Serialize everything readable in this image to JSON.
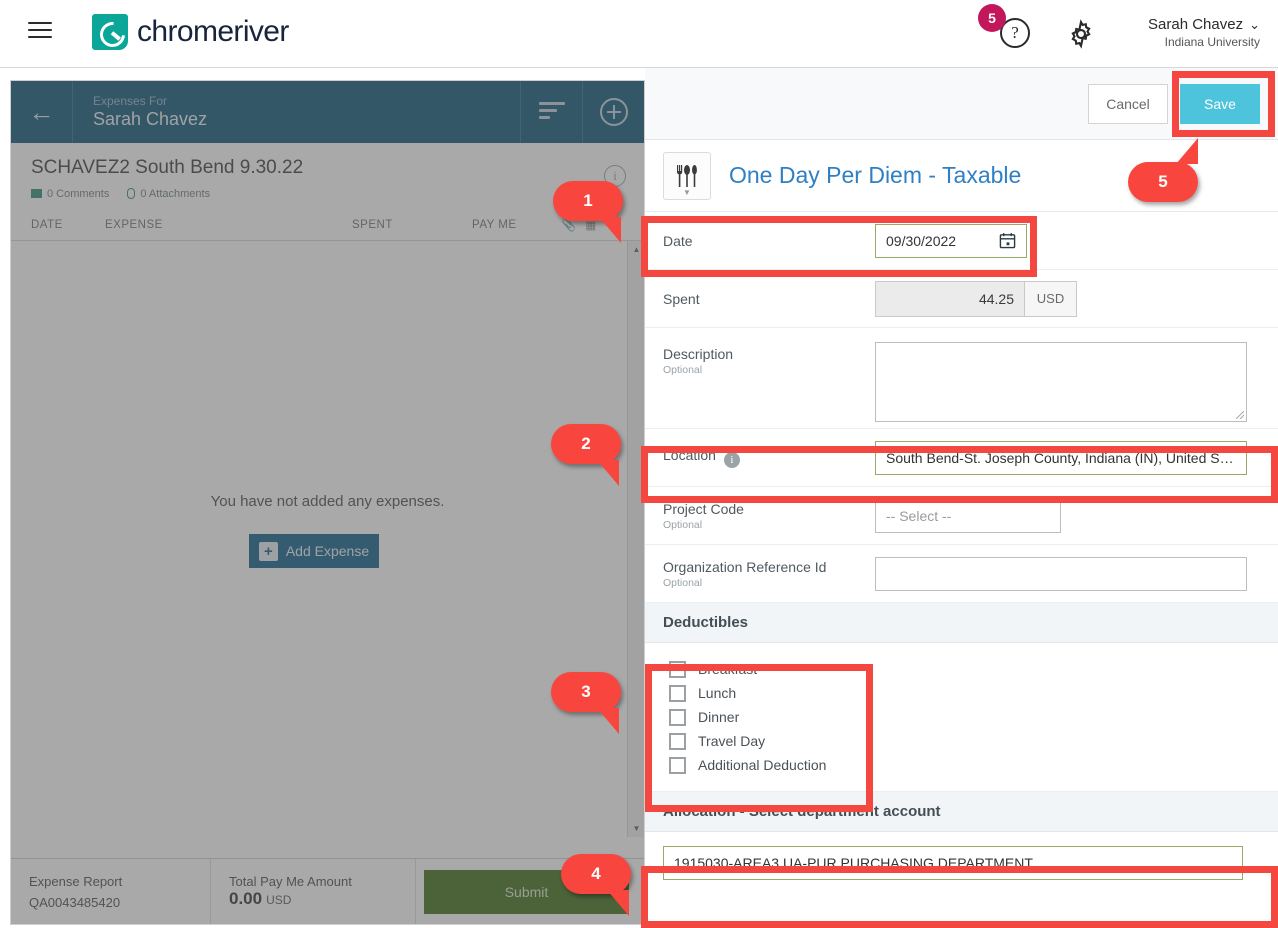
{
  "header": {
    "brand": "chromeriver",
    "menu_icon": "hamburger-icon",
    "notification_count": "5",
    "help_glyph": "?",
    "user_name": "Sarah Chavez",
    "user_caret": "⌄",
    "user_org": "Indiana University"
  },
  "left_panel": {
    "back_glyph": "←",
    "head_small": "Expenses For",
    "head_large": "Sarah Chavez",
    "report_title": "SCHAVEZ2 South Bend 9.30.22",
    "comments": "0 Comments",
    "attachments": "0 Attachments",
    "info_glyph": "i",
    "columns": {
      "date": "DATE",
      "expense": "EXPENSE",
      "spent": "SPENT",
      "pay_me": "PAY ME"
    },
    "empty_message": "You have not added any expenses.",
    "add_expense_label": "Add Expense",
    "add_expense_plus": "+",
    "footer": {
      "report_label": "Expense Report",
      "report_value": "QA0043485420",
      "total_label": "Total Pay Me Amount",
      "total_value": "0.00",
      "total_currency": "USD",
      "submit_label": "Submit"
    },
    "scroll_up": "▲",
    "scroll_down": "▼"
  },
  "right_panel": {
    "cancel_label": "Cancel",
    "save_label": "Save",
    "expense_title": "One Day Per Diem - Taxable",
    "category_icon": "utensils-icon",
    "category_chevron": "▼",
    "fields": {
      "date": {
        "label": "Date",
        "value": "09/30/2022"
      },
      "spent": {
        "label": "Spent",
        "value": "44.25",
        "currency": "USD"
      },
      "description": {
        "label": "Description",
        "sub": "Optional",
        "value": ""
      },
      "location": {
        "label": "Location",
        "info": "i",
        "value": "South Bend-St. Joseph County, Indiana (IN), United S…"
      },
      "project_code": {
        "label": "Project Code",
        "sub": "Optional",
        "placeholder": "-- Select --"
      },
      "org_ref": {
        "label": "Organization Reference Id",
        "sub": "Optional",
        "value": ""
      }
    },
    "deductibles": {
      "heading": "Deductibles",
      "items": [
        "Breakfast",
        "Lunch",
        "Dinner",
        "Travel Day",
        "Additional Deduction"
      ]
    },
    "allocation": {
      "heading": "Allocation - Select department account",
      "value": "1915030-AREA3 UA-PUR PURCHASING DEPARTMENT"
    }
  },
  "callouts": [
    {
      "num": "1"
    },
    {
      "num": "2"
    },
    {
      "num": "3"
    },
    {
      "num": "4"
    },
    {
      "num": "5"
    }
  ],
  "colors": {
    "accent_teal": "#0aa69a",
    "save_blue": "#4ec3dc",
    "highlight_red": "#f4473f",
    "header_navy": "#0b5478",
    "submit_green": "#3d6b14",
    "badge_magenta": "#c2185b"
  }
}
